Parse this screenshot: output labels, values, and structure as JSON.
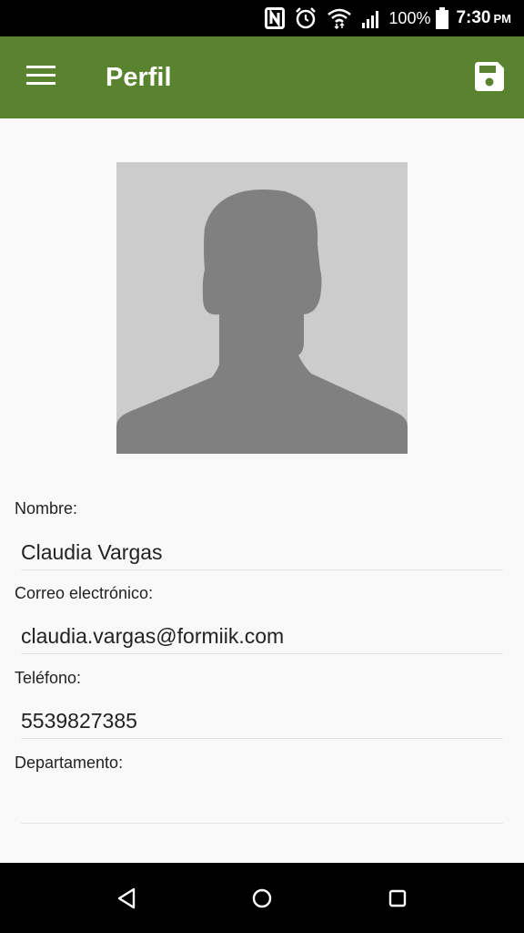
{
  "status_bar": {
    "battery": "100%",
    "time": "7:30",
    "ampm": "PM",
    "icons": [
      "nfc-icon",
      "alarm-icon",
      "wifi-icon",
      "signal-icon",
      "battery-icon"
    ]
  },
  "app_bar": {
    "title": "Perfil",
    "color": "#5a832f",
    "menu_icon": "hamburger-menu-icon",
    "save_icon": "floppy-disk-icon"
  },
  "profile": {
    "avatar_icon": "person-silhouette-icon",
    "fields": {
      "name": {
        "label": "Nombre:",
        "value": "Claudia Vargas"
      },
      "email": {
        "label": "Correo electrónico:",
        "value": "claudia.vargas@formiik.com"
      },
      "phone": {
        "label": "Teléfono:",
        "value": "5539827385"
      },
      "department": {
        "label": "Departamento:",
        "value": ""
      }
    }
  },
  "nav_bar": {
    "back_icon": "back-triangle-icon",
    "home_icon": "home-circle-icon",
    "recents_icon": "recents-square-icon"
  }
}
